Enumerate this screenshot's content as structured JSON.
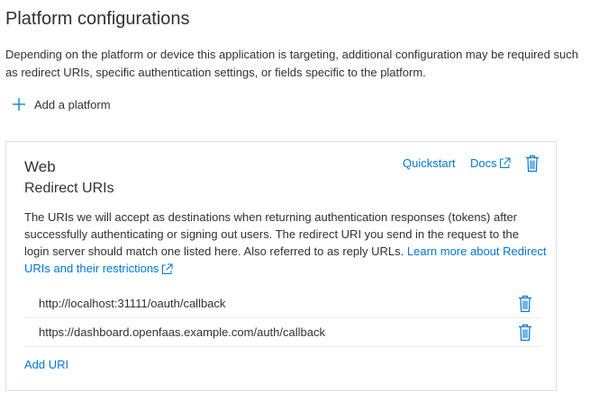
{
  "page": {
    "title": "Platform configurations",
    "description": "Depending on the platform or device this application is targeting, additional configuration may be required such as redirect URIs, specific authentication settings, or fields specific to the platform.",
    "add_platform_label": "Add a platform"
  },
  "platform_card": {
    "title": "Web",
    "subtitle": "Redirect URIs",
    "quickstart_label": "Quickstart",
    "docs_label": "Docs",
    "description": "The URIs we will accept as destinations when returning authentication responses (tokens) after successfully authenticating or signing out users. The redirect URI you send in the request to the login server should match one listed here. Also referred to as reply URLs.",
    "learn_more_label": "Learn more about Redirect URIs and their restrictions",
    "redirect_uris": [
      "http://localhost:31111/oauth/callback",
      "https://dashboard.openfaas.example.com/auth/callback"
    ],
    "add_uri_label": "Add URI"
  },
  "icons": {
    "add": "plus-icon",
    "external_link": "external-link-icon",
    "delete": "trash-icon"
  },
  "colors": {
    "link": "#0078d4",
    "text": "#323130",
    "border": "#e1dfdd"
  }
}
